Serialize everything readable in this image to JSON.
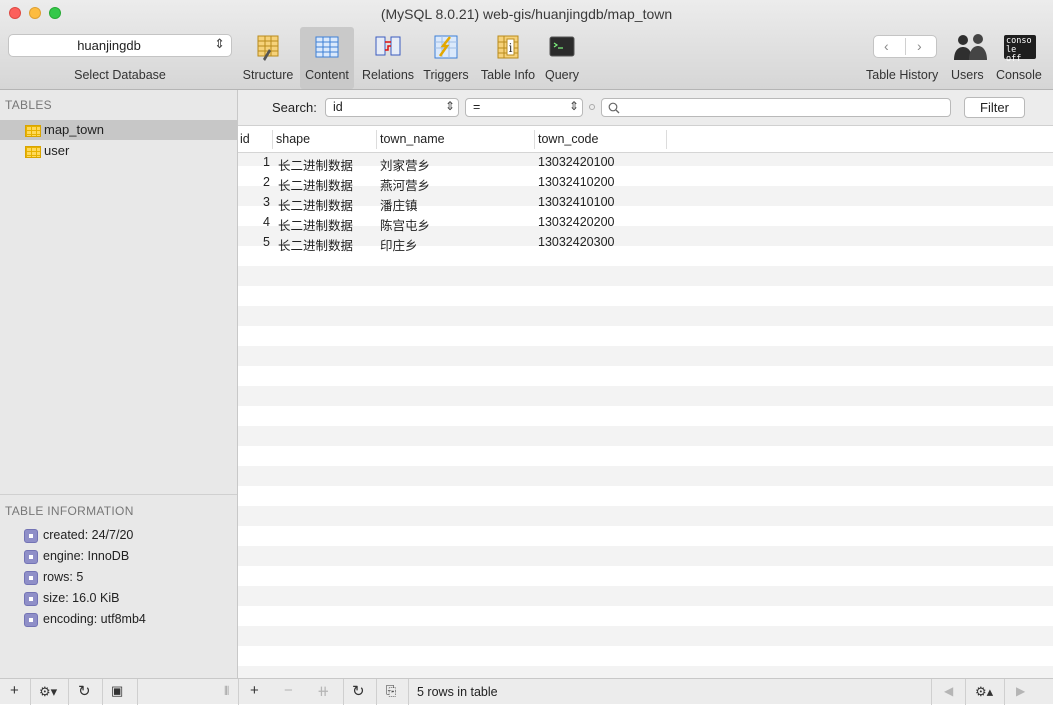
{
  "window": {
    "title": "(MySQL 8.0.21) web-gis/huanjingdb/map_town"
  },
  "database": {
    "selected": "huanjingdb",
    "label": "Select Database"
  },
  "toolbar": {
    "structure": "Structure",
    "content": "Content",
    "relations": "Relations",
    "triggers": "Triggers",
    "table_info": "Table Info",
    "query": "Query",
    "table_history": "Table History",
    "users": "Users",
    "console": "Console",
    "console_icon_text": "conso le off",
    "active_tab": "Content"
  },
  "sidebar": {
    "tables_title": "TABLES",
    "tables": [
      {
        "name": "map_town",
        "selected": true
      },
      {
        "name": "user",
        "selected": false
      }
    ],
    "info_title": "TABLE INFORMATION",
    "info": [
      "created: 24/7/20",
      "engine: InnoDB",
      "rows: 5",
      "size: 16.0 KiB",
      "encoding: utf8mb4"
    ]
  },
  "search": {
    "label": "Search:",
    "field": "id",
    "operator": "=",
    "value": "",
    "filter_button": "Filter"
  },
  "grid": {
    "columns": [
      "id",
      "shape",
      "town_name",
      "town_code"
    ],
    "rows": [
      {
        "id": "1",
        "shape": "长二进制数据",
        "town_name": "刘家营乡",
        "town_code": "13032420100"
      },
      {
        "id": "2",
        "shape": "长二进制数据",
        "town_name": "燕河营乡",
        "town_code": "13032410200"
      },
      {
        "id": "3",
        "shape": "长二进制数据",
        "town_name": "潘庄镇",
        "town_code": "13032410100"
      },
      {
        "id": "4",
        "shape": "长二进制数据",
        "town_name": "陈宫屯乡",
        "town_code": "13032420200"
      },
      {
        "id": "5",
        "shape": "长二进制数据",
        "town_name": "印庄乡",
        "town_code": "13032420300"
      }
    ]
  },
  "status": {
    "rows_info": "5 rows in table"
  },
  "colors": {
    "close": "#fc605c",
    "minimize": "#fdbc40",
    "maximize": "#34c84a",
    "selected_row": "#c7c7c7"
  }
}
